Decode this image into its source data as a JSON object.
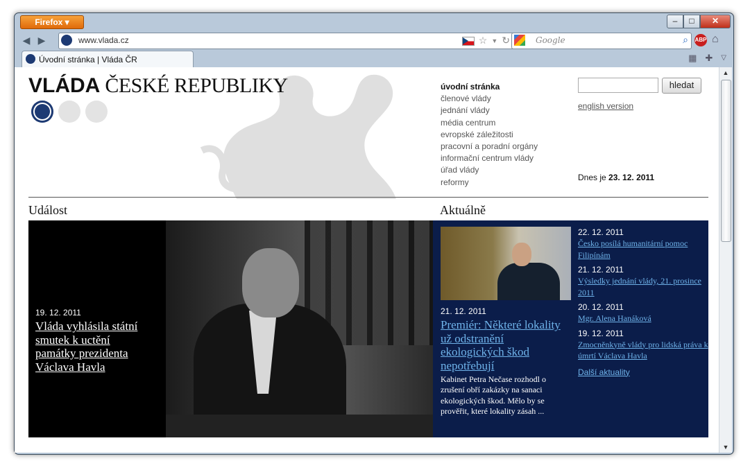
{
  "browser": {
    "app_button": "Firefox",
    "url": "www.vlada.cz",
    "search_engine_placeholder": "Google",
    "tab_title": "Úvodní stránka | Vláda ČR"
  },
  "header": {
    "logo_bold": "VLÁDA",
    "logo_rest": " ČESKÉ REPUBLIKY",
    "nav": [
      {
        "label": "úvodní stránka",
        "active": true
      },
      {
        "label": "členové vlády"
      },
      {
        "label": "jednání vlády"
      },
      {
        "label": "média centrum"
      },
      {
        "label": "evropské záležitosti"
      },
      {
        "label": "pracovní a poradní orgány"
      },
      {
        "label": "informační centrum vlády"
      },
      {
        "label": "úřad vlády"
      },
      {
        "label": "reformy"
      }
    ],
    "search_button": "hledat",
    "english_link": "english version",
    "today_prefix": "Dnes je ",
    "today_date": "23. 12. 2011"
  },
  "event": {
    "section_title": "Událost",
    "date": "19. 12. 2011",
    "title": "Vláda vyhlásila státní smutek k uctění památky prezidenta Václava Havla"
  },
  "news": {
    "section_title": "Aktuálně",
    "lead": {
      "date": "21. 12. 2011",
      "title": "Premiér: Některé lokality už odstranění ekologických škod nepotřebují",
      "text": "Kabinet Petra Nečase rozhodl o zrušení obří zakázky na sanaci ekologických škod. Mělo by se prověřit, které lokality zásah ..."
    },
    "items": [
      {
        "date": "22. 12. 2011",
        "title": "Česko posílá humanitární pomoc Filipínám"
      },
      {
        "date": "21. 12. 2011",
        "title": "Výsledky jednání vlády, 21. prosince 2011"
      },
      {
        "date": "20. 12. 2011",
        "title": "Mgr. Alena Hanáková"
      },
      {
        "date": "19. 12. 2011",
        "title": "Zmocněnkyně vlády pro lidská práva k úmrtí Václava Havla"
      }
    ],
    "more_link": "Další aktuality"
  },
  "colors": {
    "news_bg": "#0b1d4a",
    "link_light": "#6fb3ea",
    "brand_blue": "#1d3a73"
  }
}
